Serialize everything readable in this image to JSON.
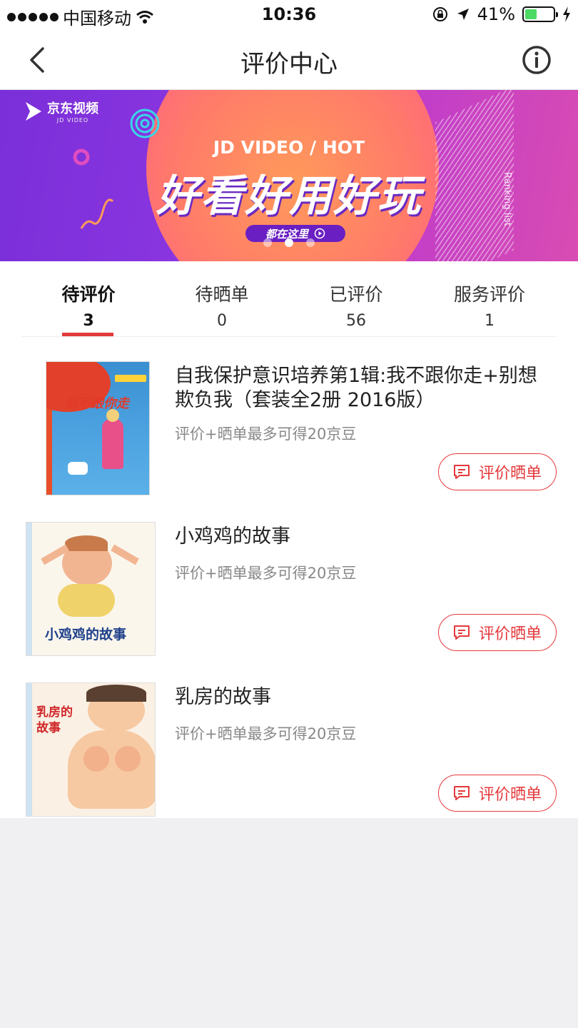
{
  "status_bar": {
    "carrier": "中国移动",
    "time": "10:36",
    "battery_percent": "41%",
    "battery_level": 0.41
  },
  "nav": {
    "title": "评价中心",
    "back_icon": "chevron-left-icon",
    "info_icon": "info-circle-icon"
  },
  "banner": {
    "logo_name": "京东视频",
    "logo_sub": "JD VIDEO",
    "headline_en": "JD VIDEO / HOT",
    "headline_cn": "好看好用好玩",
    "cta": "都在这里",
    "side_text": "Ranking list",
    "slides": 3,
    "active_slide": 2,
    "colors": {
      "bg_from": "#7a2fd8",
      "bg_to": "#d94cb2",
      "circle": "#ff7a6a"
    }
  },
  "tabs": [
    {
      "label": "待评价",
      "count": "3",
      "active": true
    },
    {
      "label": "待晒单",
      "count": "0",
      "active": false
    },
    {
      "label": "已评价",
      "count": "56",
      "active": false
    },
    {
      "label": "服务评价",
      "count": "1",
      "active": false
    }
  ],
  "products": [
    {
      "title": "自我保护意识培养第1辑:我不跟你走+别想欺负我（套装全2册 2016版）",
      "subtitle": "评价+晒单最多可得20京豆",
      "button": "评价晒单",
      "cover_text": "我不跟你走"
    },
    {
      "title": "小鸡鸡的故事",
      "subtitle": "评价+晒单最多可得20京豆",
      "button": "评价晒单",
      "cover_text": "小鸡鸡的故事"
    },
    {
      "title": "乳房的故事",
      "subtitle": "评价+晒单最多可得20京豆",
      "button": "评价晒单",
      "cover_text": "乳房的故事"
    }
  ],
  "colors": {
    "accent": "#e4393c",
    "background": "#f0f0f2"
  }
}
